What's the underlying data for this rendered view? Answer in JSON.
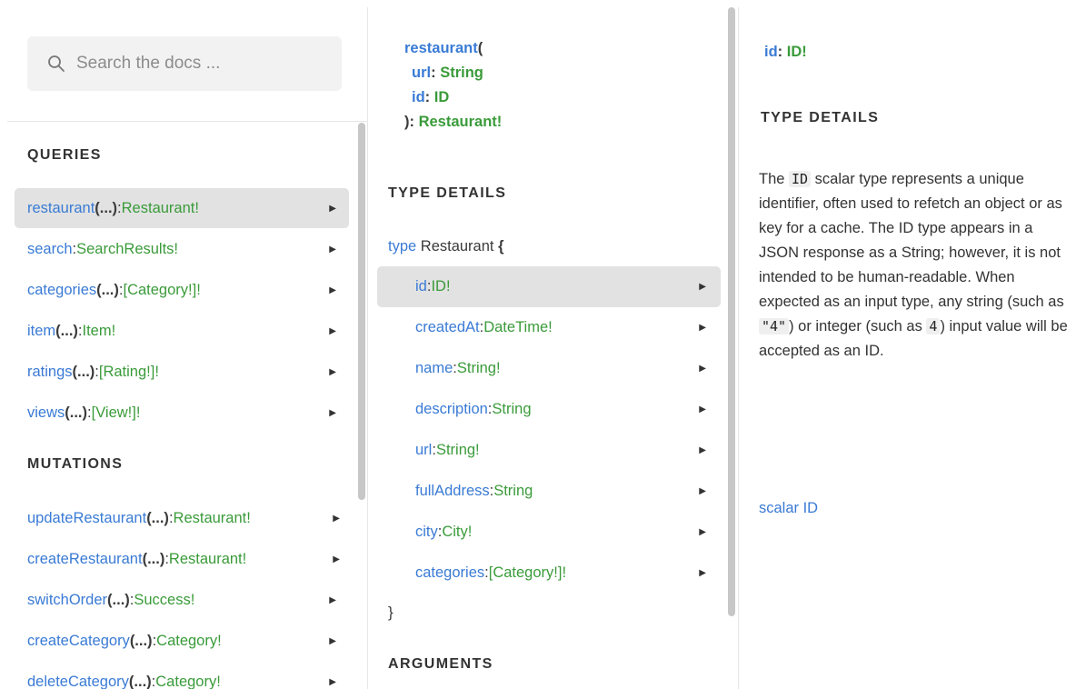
{
  "search": {
    "placeholder": "Search the docs ..."
  },
  "queries": {
    "title": "QUERIES",
    "items": [
      {
        "name": "restaurant",
        "args": "(...)",
        "sep": ": ",
        "type": "Restaurant!"
      },
      {
        "name": "search",
        "args": "",
        "sep": ": ",
        "type": "SearchResults!"
      },
      {
        "name": "categories",
        "args": "(...)",
        "sep": ": ",
        "type": "[Category!]!"
      },
      {
        "name": "item",
        "args": "(...)",
        "sep": ": ",
        "type": "Item!"
      },
      {
        "name": "ratings",
        "args": "(...)",
        "sep": ": ",
        "type": "[Rating!]!"
      },
      {
        "name": "views",
        "args": "(...)",
        "sep": ": ",
        "type": "[View!]!"
      }
    ]
  },
  "mutations": {
    "title": "MUTATIONS",
    "items": [
      {
        "name": "updateRestaurant",
        "args": "(...)",
        "sep": ": ",
        "type": "Restaurant!"
      },
      {
        "name": "createRestaurant",
        "args": "(...)",
        "sep": ": ",
        "type": "Restaurant!"
      },
      {
        "name": "switchOrder",
        "args": "(...)",
        "sep": ": ",
        "type": "Success!"
      },
      {
        "name": "createCategory",
        "args": "(...)",
        "sep": ": ",
        "type": "Category!"
      },
      {
        "name": "deleteCategory",
        "args": "(...)",
        "sep": ": ",
        "type": "Category!"
      }
    ]
  },
  "field_doc": {
    "name": "restaurant",
    "open": "(",
    "args": [
      {
        "name": "url",
        "type": "String"
      },
      {
        "name": "id",
        "type": "ID"
      }
    ],
    "close": "): ",
    "return_type": "Restaurant!",
    "type_details_title": "TYPE DETAILS",
    "type_keyword": "type",
    "type_name": "Restaurant",
    "open_brace": "{",
    "close_brace": "}",
    "fields": [
      {
        "name": "id",
        "type": "ID!"
      },
      {
        "name": "createdAt",
        "type": "DateTime!"
      },
      {
        "name": "name",
        "type": "String!"
      },
      {
        "name": "description",
        "type": "String"
      },
      {
        "name": "url",
        "type": "String!"
      },
      {
        "name": "fullAddress",
        "type": "String"
      },
      {
        "name": "city",
        "type": "City!"
      },
      {
        "name": "categories",
        "type": "[Category!]!"
      }
    ],
    "arguments_title": "ARGUMENTS"
  },
  "arg_doc": {
    "name": "id",
    "type": "ID!",
    "type_details_title": "TYPE DETAILS",
    "desc_parts": {
      "p1": "The ",
      "c1": "ID",
      "p2": " scalar type represents a unique identifier, often used to refetch an object or as key for a cache. The ID type appears in a JSON response as a String; however, it is not intended to be human-readable. When expected as an input type, any string (such as ",
      "c2": "\"4\"",
      "p3": ") or integer (such as ",
      "c3": "4",
      "p4": ") input value will be accepted as an ID."
    },
    "scalar_line": "scalar ID"
  },
  "colors": {
    "name": "#3a7bd5",
    "type": "#3a9b3a",
    "active_bg": "#e2e2e2"
  }
}
